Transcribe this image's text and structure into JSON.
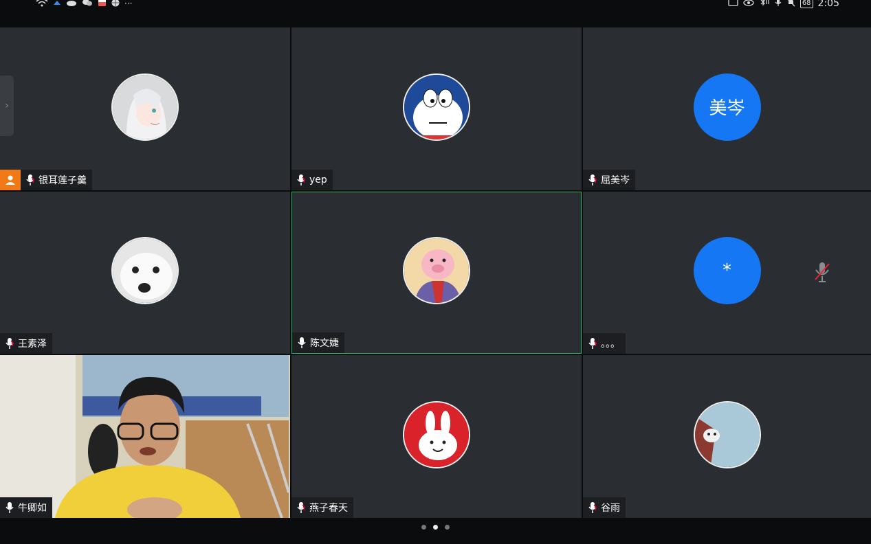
{
  "status_bar": {
    "time": "2:05",
    "battery": "68",
    "more": "···"
  },
  "participants": [
    {
      "name": "银耳莲子羹",
      "avatar_icon": "anime-girl-avatar-icon",
      "host": true
    },
    {
      "name": "yep",
      "avatar_icon": "doraemon-avatar-icon"
    },
    {
      "name": "屈美岑",
      "avatar_text": "美岑",
      "avatar_color": "#1677f5"
    },
    {
      "name": "王素泽",
      "avatar_icon": "white-dog-avatar-icon"
    },
    {
      "name": "陈文婕",
      "avatar_icon": "piglet-avatar-icon",
      "active_speaker": true
    },
    {
      "name": "。。。",
      "avatar_text": "*",
      "avatar_color": "#1677f5",
      "muted": true
    },
    {
      "name": "牛卿如",
      "video_on": true
    },
    {
      "name": "燕子春天",
      "avatar_icon": "rabbit-avatar-icon"
    },
    {
      "name": "谷雨",
      "avatar_icon": "cat-avatar-icon"
    }
  ],
  "pagination": {
    "current": 2,
    "total": 3
  },
  "colors": {
    "tile_bg": "#2a2d31",
    "active_border": "#2fb86a",
    "avatar_blue": "#1677f5",
    "host_badge": "#f27a16"
  }
}
